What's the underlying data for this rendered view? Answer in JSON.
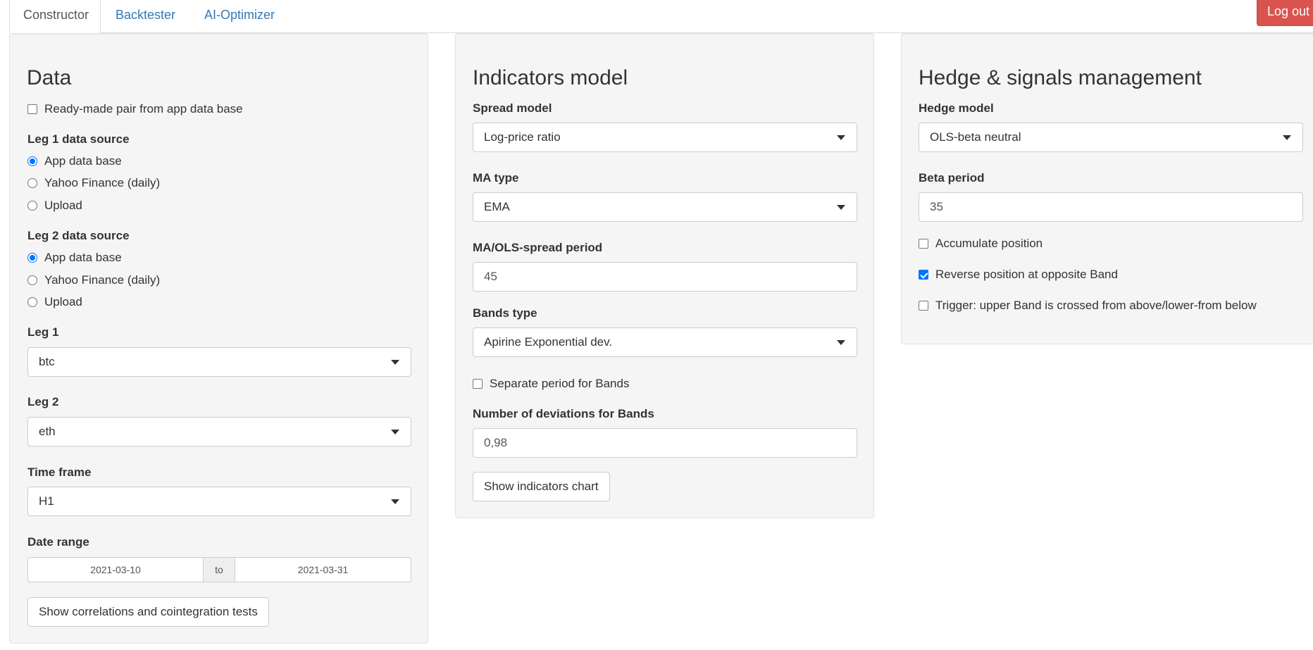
{
  "tabs": [
    {
      "label": "Constructor",
      "active": true
    },
    {
      "label": "Backtester",
      "active": false
    },
    {
      "label": "AI-Optimizer",
      "active": false
    }
  ],
  "logout_label": "Log out",
  "colors": {
    "accent": "#337ab7",
    "danger": "#d9534f",
    "checked": "#0075ff",
    "panel_bg": "#f5f5f5"
  },
  "data_panel": {
    "title": "Data",
    "ready_made": {
      "label": "Ready-made pair from app data base",
      "checked": false
    },
    "leg1_source": {
      "label": "Leg 1 data source",
      "options": [
        "App data base",
        "Yahoo Finance (daily)",
        "Upload"
      ],
      "selected": "App data base"
    },
    "leg2_source": {
      "label": "Leg 2 data source",
      "options": [
        "App data base",
        "Yahoo Finance (daily)",
        "Upload"
      ],
      "selected": "App data base"
    },
    "leg1": {
      "label": "Leg 1",
      "value": "btc"
    },
    "leg2": {
      "label": "Leg 2",
      "value": "eth"
    },
    "timeframe": {
      "label": "Time frame",
      "value": "H1"
    },
    "date_range": {
      "label": "Date range",
      "start": "2021-03-10",
      "separator": "to",
      "end": "2021-03-31"
    },
    "button": "Show correlations and cointegration tests"
  },
  "indicators_panel": {
    "title": "Indicators model",
    "spread_model": {
      "label": "Spread model",
      "value": "Log-price ratio"
    },
    "ma_type": {
      "label": "MA type",
      "value": "EMA"
    },
    "ma_period": {
      "label": "MA/OLS-spread period",
      "value": "45"
    },
    "bands_type": {
      "label": "Bands type",
      "value": "Apirine Exponential dev."
    },
    "separate_period": {
      "label": "Separate period for Bands",
      "checked": false
    },
    "num_dev": {
      "label": "Number of deviations for Bands",
      "value": "0,98"
    },
    "button": "Show indicators chart"
  },
  "hedge_panel": {
    "title": "Hedge & signals management",
    "hedge_model": {
      "label": "Hedge model",
      "value": "OLS-beta neutral"
    },
    "beta_period": {
      "label": "Beta period",
      "value": "35"
    },
    "accumulate": {
      "label": "Accumulate position",
      "checked": false
    },
    "reverse": {
      "label": "Reverse position at opposite Band",
      "checked": true
    },
    "trigger": {
      "label": "Trigger: upper Band is crossed from above/lower-from below",
      "checked": false
    }
  }
}
